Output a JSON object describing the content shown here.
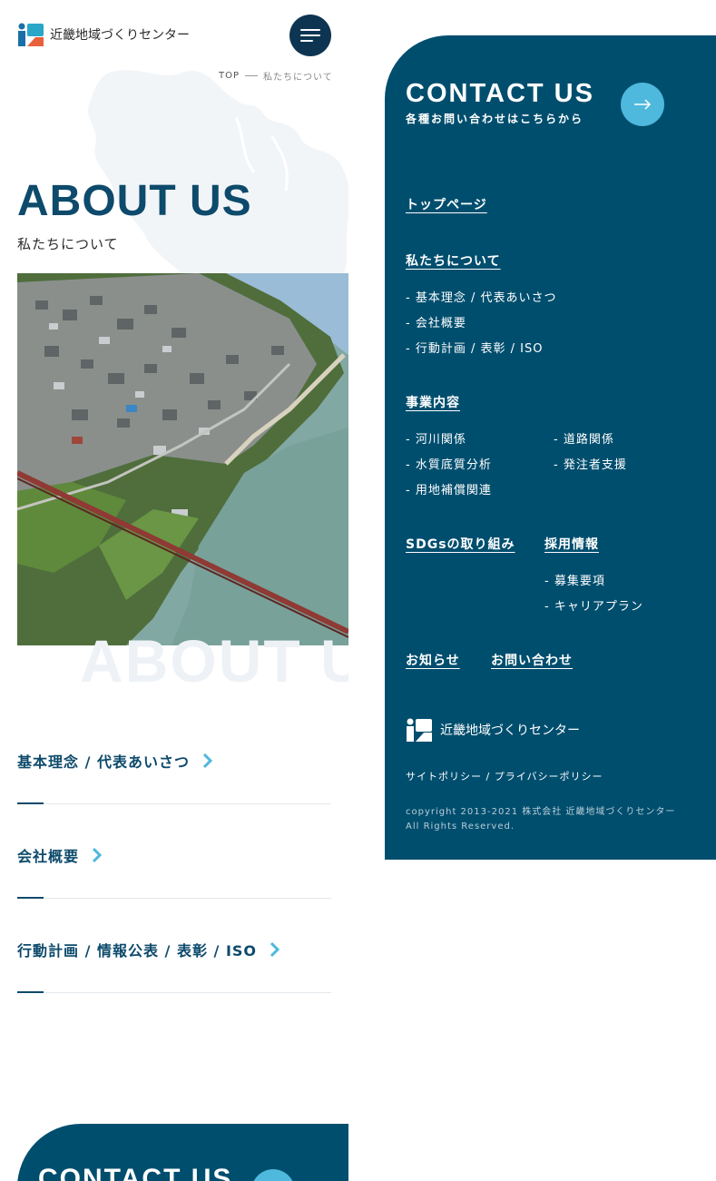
{
  "header": {
    "logo_text": "近畿地域づくりセンター",
    "menu_label": ""
  },
  "breadcrumb": {
    "home": "TOP",
    "current": "私たちについて"
  },
  "page": {
    "title": "ABOUT US",
    "subtitle": "私たちについて",
    "watermark": "ABOUT US"
  },
  "sub_links": [
    {
      "label": "基本理念 / 代表あいさつ"
    },
    {
      "label": "会社概要"
    },
    {
      "label": "行動計画 / 情報公表 / 表彰 / ISO"
    }
  ],
  "contact_bottom": {
    "title": "CONTACT US"
  },
  "menu_panel": {
    "contact_title": "CONTACT US",
    "contact_sub": "各種お問い合わせはこちらから",
    "top_page": "トップページ",
    "about": {
      "head": "私たちについて",
      "items": [
        "- 基本理念 / 代表あいさつ",
        "- 会社概要",
        "- 行動計画 / 表彰 / ISO"
      ]
    },
    "business": {
      "head": "事業内容",
      "items_left": [
        "- 河川関係",
        "- 水質底質分析",
        "- 用地補償関連"
      ],
      "items_right": [
        "- 道路関係",
        "- 発注者支援"
      ]
    },
    "sdgs": "SDGsの取り組み",
    "recruit": {
      "head": "採用情報",
      "items": [
        "- 募集要項",
        "- キャリアプラン"
      ]
    },
    "news": "お知らせ",
    "inquiry": "お問い合わせ",
    "logo_text": "近畿地域づくりセンター",
    "policy": "サイトポリシー / プライバシーポリシー",
    "copyright_line1": "copyright 2013-2021 株式会社 近畿地域づくりセンター",
    "copyright_line2": "All Rights Reserved."
  },
  "colors": {
    "navy": "#004e6e",
    "dark_navy": "#0d3552",
    "accent_blue": "#4fb8dd",
    "logo_orange": "#e8603c",
    "logo_blue": "#1b6fa8"
  }
}
